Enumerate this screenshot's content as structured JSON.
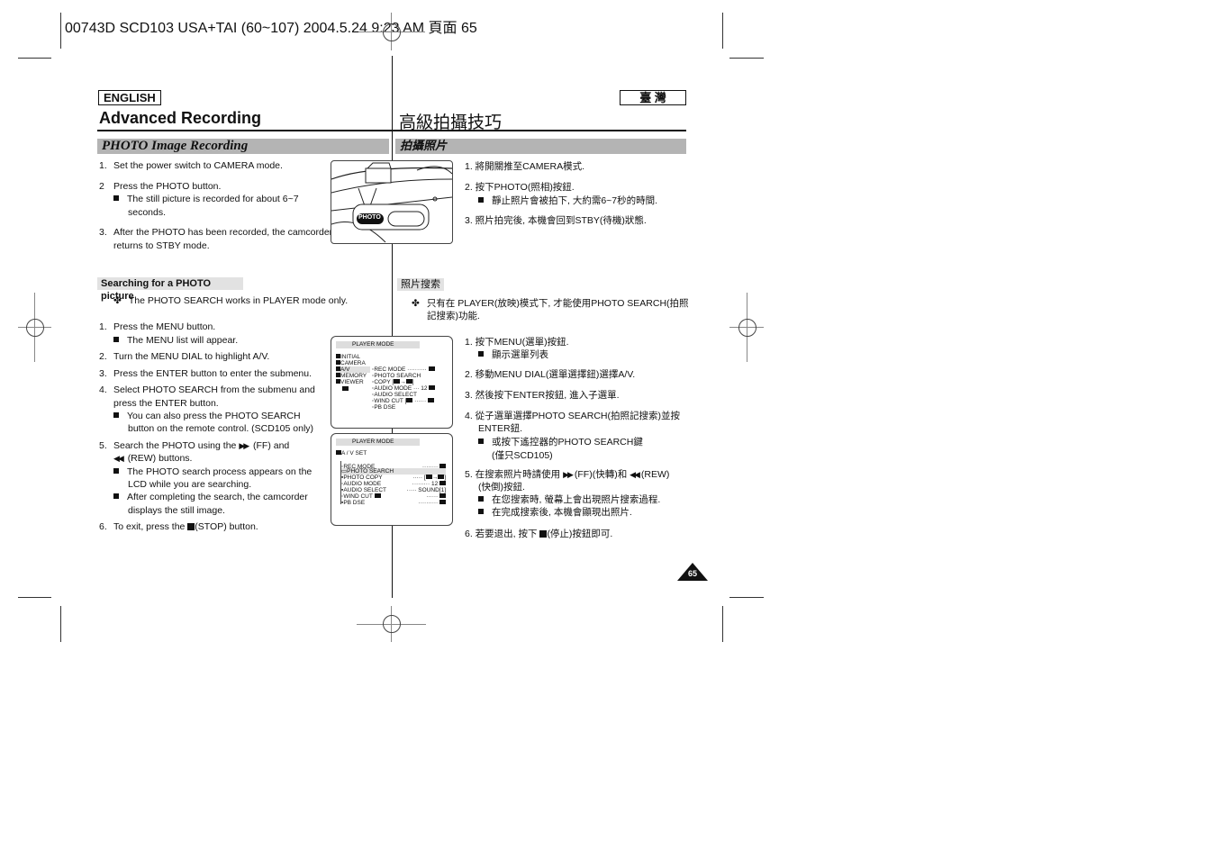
{
  "print_header": "00743D SCD103 USA+TAI (60~107)  2004.5.24  9:23 AM  頁面 65",
  "left": {
    "lang_label": "ENGLISH",
    "title": "Advanced Recording",
    "section_title": "PHOTO Image Recording",
    "steps_a": [
      {
        "num": "1.",
        "text": "Set the power switch to CAMERA mode."
      },
      {
        "num": "2",
        "text": "Press the PHOTO button."
      },
      {
        "bullet": "The still picture is recorded for about 6~7"
      },
      {
        "cont": "seconds."
      },
      {
        "num": "3.",
        "text": "After the PHOTO has been recorded, the camcorder"
      },
      {
        "cont": "returns to STBY mode."
      }
    ],
    "subsection_title": "Searching for a PHOTO picture",
    "note": "The PHOTO SEARCH works in PLAYER mode only.",
    "steps_b": [
      {
        "num": "1.",
        "text": "Press the MENU button."
      },
      {
        "bullet": "The MENU list will appear."
      },
      {
        "num": "2.",
        "text": "Turn the MENU DIAL to highlight A/V."
      },
      {
        "num": "3.",
        "text": "Press the ENTER button to enter the submenu."
      },
      {
        "num": "4.",
        "text": "Select PHOTO SEARCH from the submenu and"
      },
      {
        "cont": "press the ENTER button."
      },
      {
        "bullet": "You can also press the PHOTO SEARCH"
      },
      {
        "cont2": "button on the remote control. (SCD105 only)"
      },
      {
        "num": "5.",
        "text_pre": "Search the PHOTO using the",
        "text_post": "(FF) and"
      },
      {
        "cont_rew": "(REW) buttons."
      },
      {
        "bullet": "The PHOTO search process appears on the"
      },
      {
        "cont2": "LCD while you are searching."
      },
      {
        "bullet": "After completing the search, the camcorder"
      },
      {
        "cont2": "displays the still image."
      },
      {
        "num": "6.",
        "text_pre": "To exit, press the",
        "text_post": "(STOP) button."
      }
    ]
  },
  "right": {
    "lang_label": "臺 灣",
    "title": "高級拍攝技巧",
    "section_title": "拍攝照片",
    "steps_a": [
      "1.  將開關推至CAMERA模式.",
      "2.  按下PHOTO(照相)按鈕.",
      "靜止照片會被拍下, 大約需6~7秒的時間.",
      "3.  照片拍完後, 本機會回到STBY(待機)狀態."
    ],
    "subsection_title": "照片搜索",
    "note_line1": "只有在 PLAYER(放映)模式下, 才能使用PHOTO SEARCH(拍照",
    "note_line2": "記搜索)功能.",
    "steps_b": {
      "s1": "1.  按下MENU(選單)按鈕.",
      "s1b": "顯示選單列表",
      "s2": "2.  移動MENU DIAL(選單選擇鈕)選擇A/V.",
      "s3": "3.  然後按下ENTER按鈕, 進入子選單.",
      "s4a": "4.  從子選單選擇PHOTO SEARCH(拍照記搜索)並按",
      "s4b": "ENTER鈕.",
      "s4c": "或按下遙控器的PHOTO SEARCH鍵",
      "s4d": "(僅只SCD105)",
      "s5a_pre": "5.  在搜索照片時請使用",
      "s5a_mid": "(FF)(快轉)和",
      "s5a_post": "(REW)",
      "s5b": "(快倒)按鈕.",
      "s5c": "在您搜索時, 螢幕上會出現照片搜索過程.",
      "s5d": "在完成搜索後, 本機會顯現出照片.",
      "s6_pre": "6.  若要退出, 按下",
      "s6_post": "(停止)按鈕即可."
    }
  },
  "camera_illustration": {
    "button_label": "PHOTO"
  },
  "menu_screen_1": {
    "header": "PLAYER MODE",
    "left_items": [
      "INITIAL",
      "CAMERA",
      "A/V",
      "MEMORY",
      "VIEWER"
    ],
    "right_items": [
      "REC MODE ··········",
      "PHOTO SEARCH",
      "COPY  [",
      "AUDIO MODE ···  12",
      "AUDIO SELECT",
      "WIND CUT  [",
      "PB DSE"
    ]
  },
  "menu_screen_2": {
    "header": "PLAYER MODE",
    "title": "A / V SET",
    "items": [
      {
        "label": "REC MODE",
        "value": ""
      },
      {
        "label": "PHOTO SEARCH",
        "value": ""
      },
      {
        "label": "PHOTO COPY",
        "value": "["
      },
      {
        "label": "AUDIO MODE",
        "value": "12"
      },
      {
        "label": "AUDIO SELECT",
        "value": "SOUND[1]"
      },
      {
        "label": "WIND CUT",
        "value": ""
      },
      {
        "label": "PB DSE",
        "value": ""
      }
    ]
  },
  "page_number": "65"
}
